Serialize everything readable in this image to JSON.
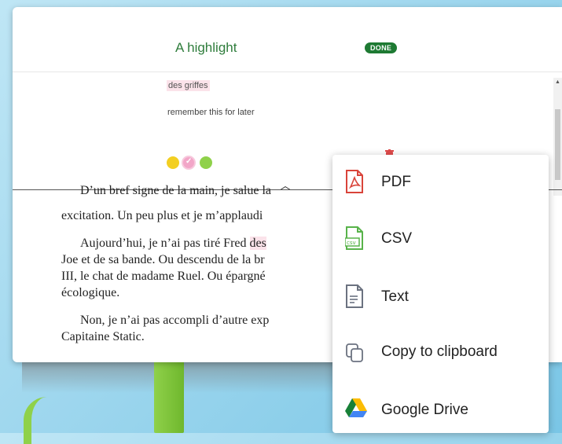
{
  "highlight": {
    "title": "A highlight",
    "status": "DONE",
    "text": "des griffes",
    "note": "remember this for later"
  },
  "book": {
    "line0": "D’un bref signe de la main, je salue la",
    "line1": "excitation. Un peu plus et je m’applaudi",
    "line2a": "Aujourd’hui, je n’ai pas tiré Fred ",
    "line2b": "des",
    "line3": "Joe et de sa bande. Ou descendu de la br",
    "line4": "III, le chat de madame Ruel. Ou épargné",
    "line5": "écologique.",
    "line6": "Non, je n’ai pas accompli d’autre exp",
    "line7": "Capitaine Static."
  },
  "export_menu": {
    "items": [
      {
        "label": "PDF",
        "icon": "pdf-icon"
      },
      {
        "label": "CSV",
        "icon": "csv-icon"
      },
      {
        "label": "Text",
        "icon": "text-file-icon"
      },
      {
        "label": "Copy to clipboard",
        "icon": "copy-icon"
      },
      {
        "label": "Google Drive",
        "icon": "google-drive-icon"
      }
    ],
    "csv_badge": "csv"
  },
  "colors": {
    "title_green": "#2f7d3c",
    "done_badge": "#1e7a33",
    "pdf_red": "#d9443a",
    "csv_green": "#58b34a",
    "text_gray": "#6b7280",
    "highlight_pink": "#fbe3ea",
    "color_yellow": "#f3cf22",
    "color_pink": "#f2a6c8",
    "color_green": "#8fd14a"
  }
}
